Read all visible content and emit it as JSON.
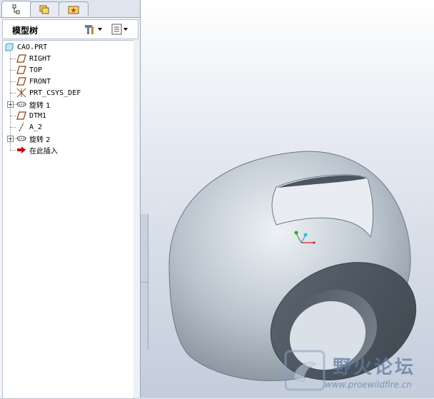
{
  "tabs": [
    {
      "icon": "model-tree-icon"
    },
    {
      "icon": "folder-browser-icon"
    },
    {
      "icon": "favorites-icon"
    }
  ],
  "tree_header": {
    "title": "模型树",
    "settings_icon": "tools-icon",
    "show_icon": "list-icon"
  },
  "tree": {
    "items": [
      {
        "label": "CAO.PRT",
        "icon": "part-icon"
      },
      {
        "label": "RIGHT",
        "icon": "datum-plane-icon"
      },
      {
        "label": "TOP",
        "icon": "datum-plane-icon"
      },
      {
        "label": "FRONT",
        "icon": "datum-plane-icon"
      },
      {
        "label": "PRT_CSYS_DEF",
        "icon": "coordinate-system-icon"
      },
      {
        "label": "旋转 1",
        "icon": "revolve-icon"
      },
      {
        "label": "DTM1",
        "icon": "datum-plane-icon"
      },
      {
        "label": "A_2",
        "icon": "datum-axis-icon"
      },
      {
        "label": "旋转 2",
        "icon": "revolve-icon"
      },
      {
        "label": "在此插入",
        "icon": "insert-here-arrow-icon"
      }
    ]
  },
  "watermark": {
    "name": "野火论坛",
    "url": "www.proewildfire.cn"
  },
  "colors": {
    "panel_bg": "#f2f4f7",
    "model_surface": "#b9c3cd",
    "datum_plane": "#8b4513",
    "insert_arrow": "#cc0000"
  }
}
